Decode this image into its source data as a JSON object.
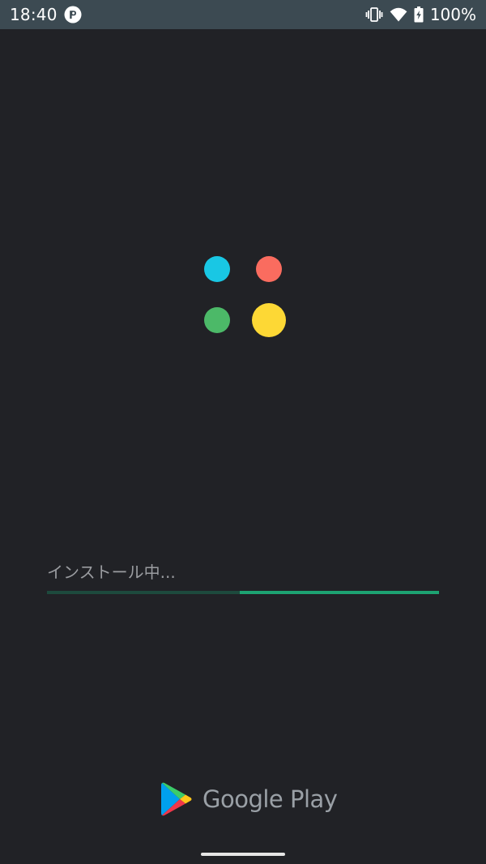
{
  "status_bar": {
    "time": "18:40",
    "battery_percent": "100%",
    "icons": [
      "app-notification-icon",
      "vibrate-icon",
      "wifi-icon",
      "battery-charging-icon"
    ]
  },
  "app_logo": {
    "colors": [
      "#19c7e4",
      "#fa6c5f",
      "#4cb968",
      "#fdd835"
    ]
  },
  "install": {
    "status_text": "インストール中...",
    "progress_indeterminate": true,
    "colors": {
      "track": "#1d4a3d",
      "fill": "#1da372"
    }
  },
  "footer": {
    "brand_text": "Google Play",
    "icon": "google-play-icon"
  },
  "navigation": {
    "gesture_handle": true
  }
}
